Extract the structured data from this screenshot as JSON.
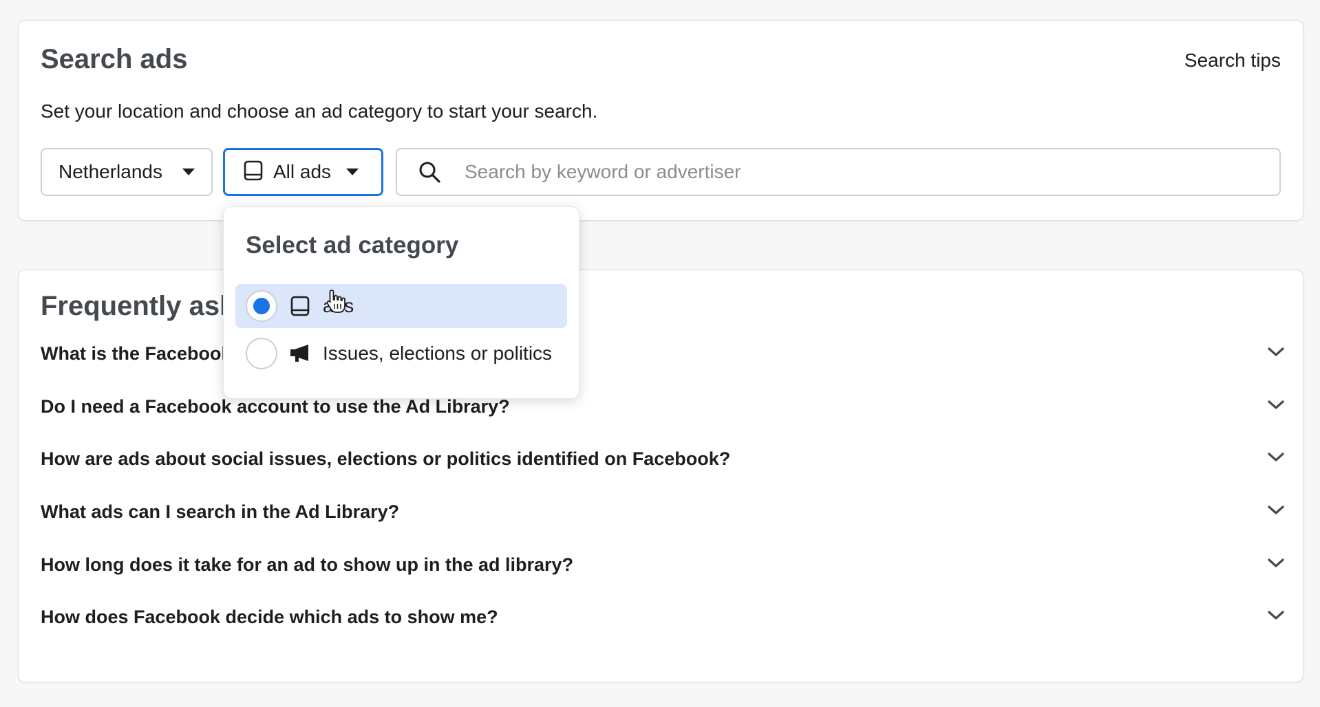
{
  "search_panel": {
    "title": "Search ads",
    "tips_link": "Search tips",
    "subtitle": "Set your location and choose an ad category to start your search.",
    "country_select": {
      "value": "Netherlands",
      "icon": "caret-down-icon"
    },
    "category_select": {
      "value": "All ads",
      "icon": "tablet-icon"
    },
    "search": {
      "placeholder": "Search by keyword or advertiser",
      "value": "",
      "icon": "search-icon"
    }
  },
  "category_dropdown": {
    "title": "Select ad category",
    "options": [
      {
        "label": "ads",
        "icon": "tablet-icon",
        "selected": true
      },
      {
        "label": "Issues, elections or politics",
        "icon": "megaphone-icon",
        "selected": false
      }
    ]
  },
  "faq": {
    "title": "Frequently ask",
    "items": [
      {
        "question": "What is the Facebook"
      },
      {
        "question": "Do I need a Facebook account to use the Ad Library?"
      },
      {
        "question": "How are ads about social issues, elections or politics identified on Facebook?"
      },
      {
        "question": "What ads can I search in the Ad Library?"
      },
      {
        "question": "How long does it take for an ad to show up in the ad library?"
      },
      {
        "question": "How does Facebook decide which ads to show me?"
      }
    ]
  },
  "colors": {
    "accent": "#1b74e4",
    "selected_bg": "#dbe6fa",
    "heading": "#444950",
    "text": "#1c1e21"
  }
}
